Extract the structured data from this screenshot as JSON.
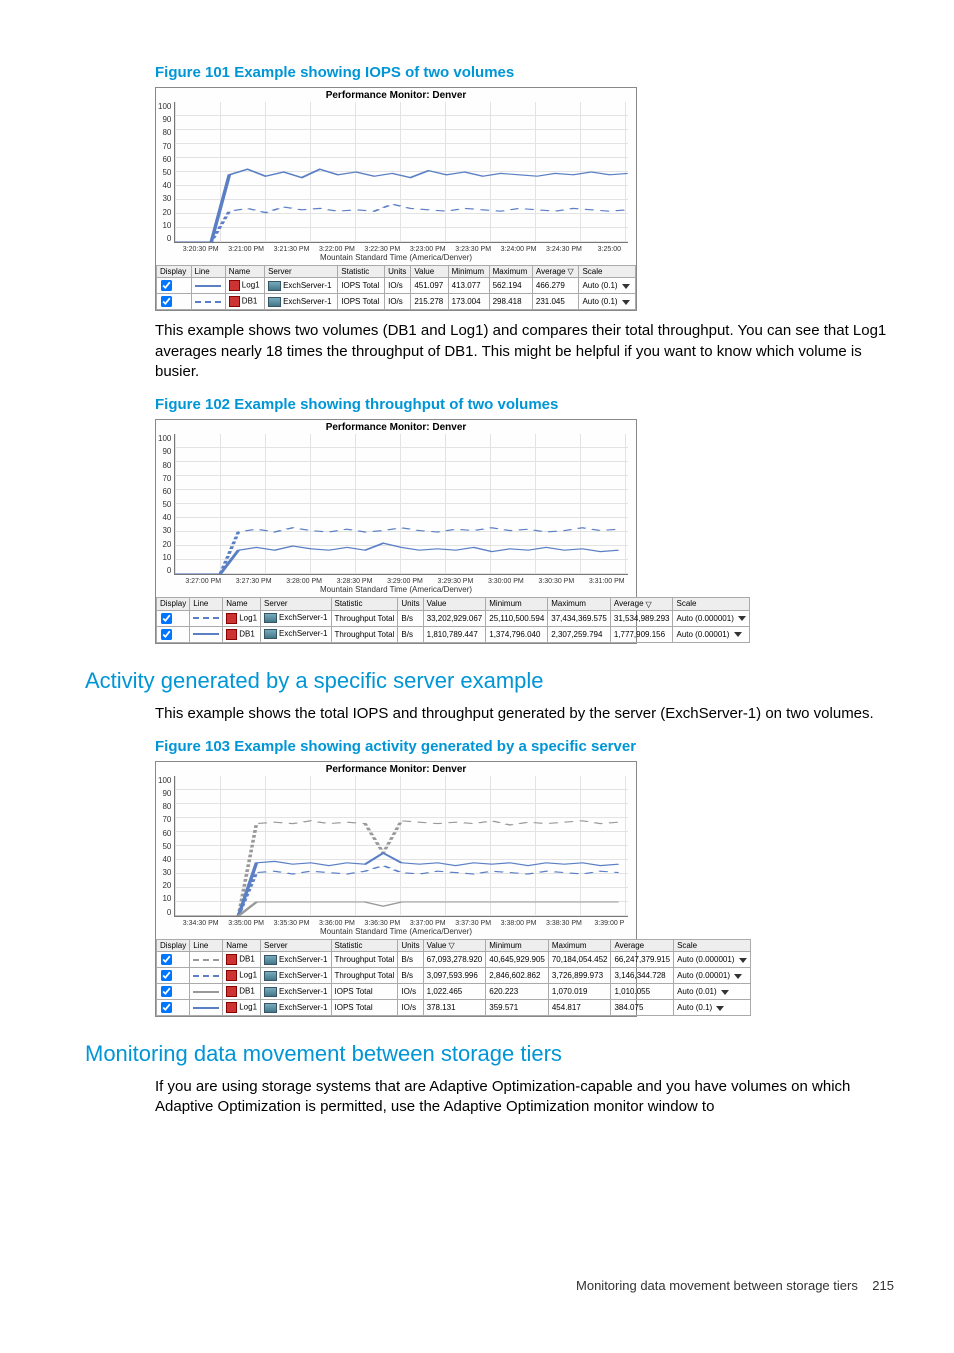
{
  "figures": {
    "f101": {
      "caption": "Figure 101 Example showing IOPS of two volumes",
      "chart_title": "Performance Monitor: Denver",
      "xaxis_label": "Mountain Standard Time (America/Denver)"
    },
    "f102": {
      "caption": "Figure 102 Example showing throughput of two volumes",
      "chart_title": "Performance Monitor: Denver",
      "xaxis_label": "Mountain Standard Time (America/Denver)"
    },
    "f103": {
      "caption": "Figure 103 Example showing activity generated by a specific server",
      "chart_title": "Performance Monitor: Denver",
      "xaxis_label": "Mountain Standard Time (America/Denver)"
    }
  },
  "para1": "This example shows two volumes (DB1 and Log1) and compares their total throughput. You can see that Log1 averages nearly 18 times the throughput of DB1. This might be helpful if you want to know which volume is busier.",
  "h2a": "Activity generated by a specific server example",
  "para2": "This example shows the total IOPS and throughput generated by the server (ExchServer-1) on two volumes.",
  "h2b": "Monitoring data movement between storage tiers",
  "para3": "If you are using storage systems that are Adaptive Optimization-capable and you have volumes on which Adaptive Optimization is permitted, use the Adaptive Optimization monitor window to",
  "legend_headers": {
    "display": "Display",
    "line": "Line",
    "name": "Name",
    "server": "Server",
    "statistic": "Statistic",
    "units": "Units",
    "value": "Value",
    "minimum": "Minimum",
    "maximum": "Maximum",
    "average": "Average",
    "scale": "Scale"
  },
  "table101": {
    "rows": [
      {
        "name": "Log1",
        "server": "ExchServer-1",
        "statistic": "IOPS Total",
        "units": "IO/s",
        "value": "451.097",
        "minimum": "413.077",
        "maximum": "562.194",
        "average": "466.279",
        "scale": "Auto (0.1)",
        "color": "#5a7fc4",
        "dash": false
      },
      {
        "name": "DB1",
        "server": "ExchServer-1",
        "statistic": "IOPS Total",
        "units": "IO/s",
        "value": "215.278",
        "minimum": "173.004",
        "maximum": "298.418",
        "average": "231.045",
        "scale": "Auto (0.1)",
        "color": "#5a7fc4",
        "dash": true
      }
    ]
  },
  "table102": {
    "rows": [
      {
        "name": "Log1",
        "server": "ExchServer-1",
        "statistic": "Throughput Total",
        "units": "B/s",
        "value": "33,202,929.067",
        "minimum": "25,110,500.594",
        "maximum": "37,434,369.575",
        "average": "31,534,989.293",
        "scale": "Auto (0.000001)",
        "color": "#5a7fc4",
        "dash": true
      },
      {
        "name": "DB1",
        "server": "ExchServer-1",
        "statistic": "Throughput Total",
        "units": "B/s",
        "value": "1,810,789.447",
        "minimum": "1,374,796.040",
        "maximum": "2,307,259.794",
        "average": "1,777,909.156",
        "scale": "Auto (0.00001)",
        "color": "#5a7fc4",
        "dash": false
      }
    ]
  },
  "table103": {
    "rows": [
      {
        "name": "DB1",
        "server": "ExchServer-1",
        "statistic": "Throughput Total",
        "units": "B/s",
        "value": "67,093,278.920",
        "minimum": "40,645,929.905",
        "maximum": "70,184,054.452",
        "average": "66,247,379.915",
        "scale": "Auto (0.000001)",
        "color": "#999",
        "dash": true
      },
      {
        "name": "Log1",
        "server": "ExchServer-1",
        "statistic": "Throughput Total",
        "units": "B/s",
        "value": "3,097,593.996",
        "minimum": "2,846,602.862",
        "maximum": "3,726,899.973",
        "average": "3,146,344.728",
        "scale": "Auto (0.00001)",
        "color": "#5a7fc4",
        "dash": true
      },
      {
        "name": "DB1",
        "server": "ExchServer-1",
        "statistic": "IOPS Total",
        "units": "IO/s",
        "value": "1,022.465",
        "minimum": "620.223",
        "maximum": "1,070.019",
        "average": "1,010.055",
        "scale": "Auto (0.01)",
        "color": "#999",
        "dash": false
      },
      {
        "name": "Log1",
        "server": "ExchServer-1",
        "statistic": "IOPS Total",
        "units": "IO/s",
        "value": "378.131",
        "minimum": "359.571",
        "maximum": "454.817",
        "average": "384.075",
        "scale": "Auto (0.1)",
        "color": "#5a7fc4",
        "dash": false
      }
    ]
  },
  "chart_data": [
    {
      "id": "f101",
      "type": "line",
      "title": "Performance Monitor: Denver",
      "ylabel": "",
      "xlabel": "Mountain Standard Time (America/Denver)",
      "ylim": [
        0,
        100
      ],
      "x": [
        "3:20:30 PM",
        "3:21:00 PM",
        "3:21:30 PM",
        "3:22:00 PM",
        "3:22:30 PM",
        "3:23:00 PM",
        "3:23:30 PM",
        "3:24:00 PM",
        "3:24:30 PM",
        "3:25:00"
      ],
      "series": [
        {
          "name": "Log1 IOPS Total ×0.1",
          "values": [
            0,
            0,
            48,
            52,
            47,
            50,
            46,
            52,
            48,
            50,
            47,
            49,
            46,
            51,
            48,
            50,
            47,
            49,
            48,
            47
          ]
        },
        {
          "name": "DB1 IOPS Total ×0.1",
          "values": [
            0,
            0,
            22,
            24,
            21,
            25,
            23,
            24,
            22,
            23,
            22,
            27,
            24,
            23,
            22,
            24,
            23,
            22,
            24,
            23
          ]
        }
      ]
    },
    {
      "id": "f102",
      "type": "line",
      "title": "Performance Monitor: Denver",
      "ylabel": "",
      "xlabel": "Mountain Standard Time (America/Denver)",
      "ylim": [
        0,
        100
      ],
      "x": [
        "3:27:00 PM",
        "3:27:30 PM",
        "3:28:00 PM",
        "3:28:30 PM",
        "3:29:00 PM",
        "3:29:30 PM",
        "3:30:00 PM",
        "3:30:30 PM",
        "3:31:00 PM"
      ],
      "series": [
        {
          "name": "Log1 Throughput ×1e-6",
          "values": [
            0,
            0,
            30,
            32,
            30,
            33,
            31,
            30,
            32,
            30,
            31,
            33,
            31,
            30,
            32,
            31,
            33,
            31
          ]
        },
        {
          "name": "DB1 Throughput ×1e-5",
          "values": [
            0,
            0,
            17,
            19,
            17,
            20,
            18,
            17,
            19,
            17,
            22,
            19,
            17,
            18,
            17,
            19,
            16,
            18
          ]
        }
      ]
    },
    {
      "id": "f103",
      "type": "line",
      "title": "Performance Monitor: Denver",
      "ylabel": "",
      "xlabel": "Mountain Standard Time (America/Denver)",
      "ylim": [
        0,
        100
      ],
      "x": [
        "3:34:30 PM",
        "3:35:00 PM",
        "3:35:30 PM",
        "3:36:00 PM",
        "3:36:30 PM",
        "3:37:00 PM",
        "3:37:30 PM",
        "3:38:00 PM",
        "3:38:30 PM",
        "3:39:00 P"
      ],
      "series": [
        {
          "name": "DB1 Throughput ×1e-6",
          "values": [
            0,
            0,
            0,
            66,
            67,
            66,
            68,
            66,
            67,
            45,
            68,
            67,
            66,
            67,
            66,
            68,
            65,
            67,
            66,
            67
          ]
        },
        {
          "name": "Log1 Throughput ×1e-5",
          "values": [
            0,
            0,
            0,
            31,
            32,
            30,
            32,
            31,
            30,
            36,
            31,
            30,
            32,
            31,
            30,
            32,
            31,
            30,
            32,
            31
          ]
        },
        {
          "name": "DB1 IOPS ×0.01",
          "values": [
            0,
            0,
            0,
            10,
            10,
            10,
            10,
            10,
            10,
            7,
            10,
            10,
            10,
            10,
            10,
            10,
            10,
            10,
            10,
            10
          ]
        },
        {
          "name": "Log1 IOPS ×0.1",
          "values": [
            0,
            0,
            0,
            38,
            39,
            37,
            39,
            38,
            37,
            45,
            38,
            37,
            39,
            38,
            37,
            39,
            38,
            37,
            39,
            38
          ]
        }
      ]
    }
  ],
  "footer": {
    "text": "Monitoring data movement between storage tiers",
    "page": "215"
  }
}
